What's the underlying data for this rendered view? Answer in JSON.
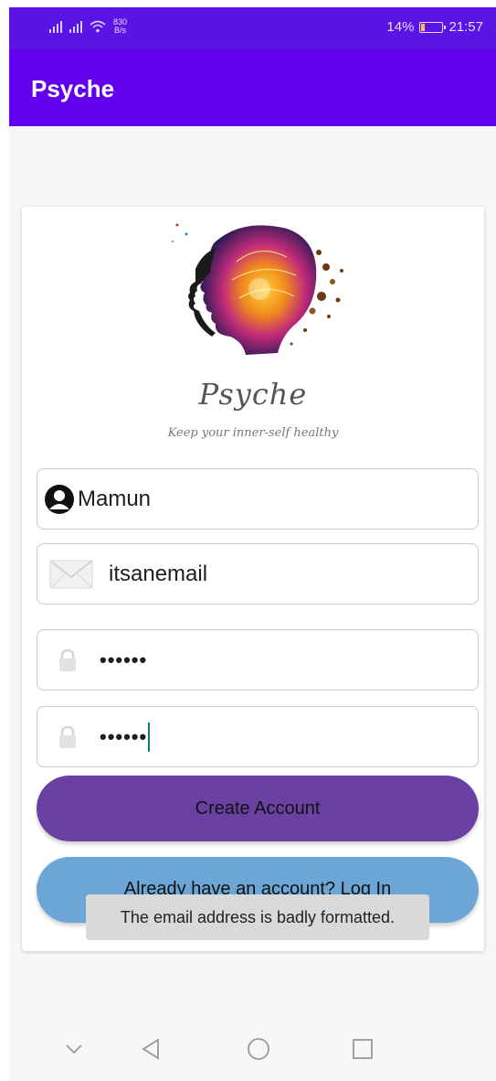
{
  "status_bar": {
    "net_speed_value": "830",
    "net_speed_unit": "B/s",
    "battery_text": "14%",
    "battery_level": 0.14,
    "time": "21:57"
  },
  "app_bar": {
    "title": "Psyche"
  },
  "brand": {
    "name": "Psyche",
    "tagline": "Keep your inner-self healthy"
  },
  "form": {
    "name_value": "Mamun",
    "email_value": "itsanemail",
    "password_mask": "••••••",
    "confirm_password_mask": "••••••"
  },
  "buttons": {
    "create_account": "Create Account",
    "login": "Already have an account? Log In"
  },
  "toast": {
    "message": "The email address is badly formatted."
  },
  "colors": {
    "status_bar": "#5b14e6",
    "app_bar": "#6200ee",
    "create_button": "#6a41a3",
    "login_button": "#6ba6d6",
    "toast_bg": "#d9d9d9"
  },
  "icons": {
    "name_field": "person-icon",
    "email_field": "envelope-icon",
    "password_field": "lock-icon",
    "nav_collapse": "chevron-down-icon",
    "nav_back": "back-triangle-icon",
    "nav_home": "home-circle-icon",
    "nav_recents": "recents-square-icon"
  }
}
